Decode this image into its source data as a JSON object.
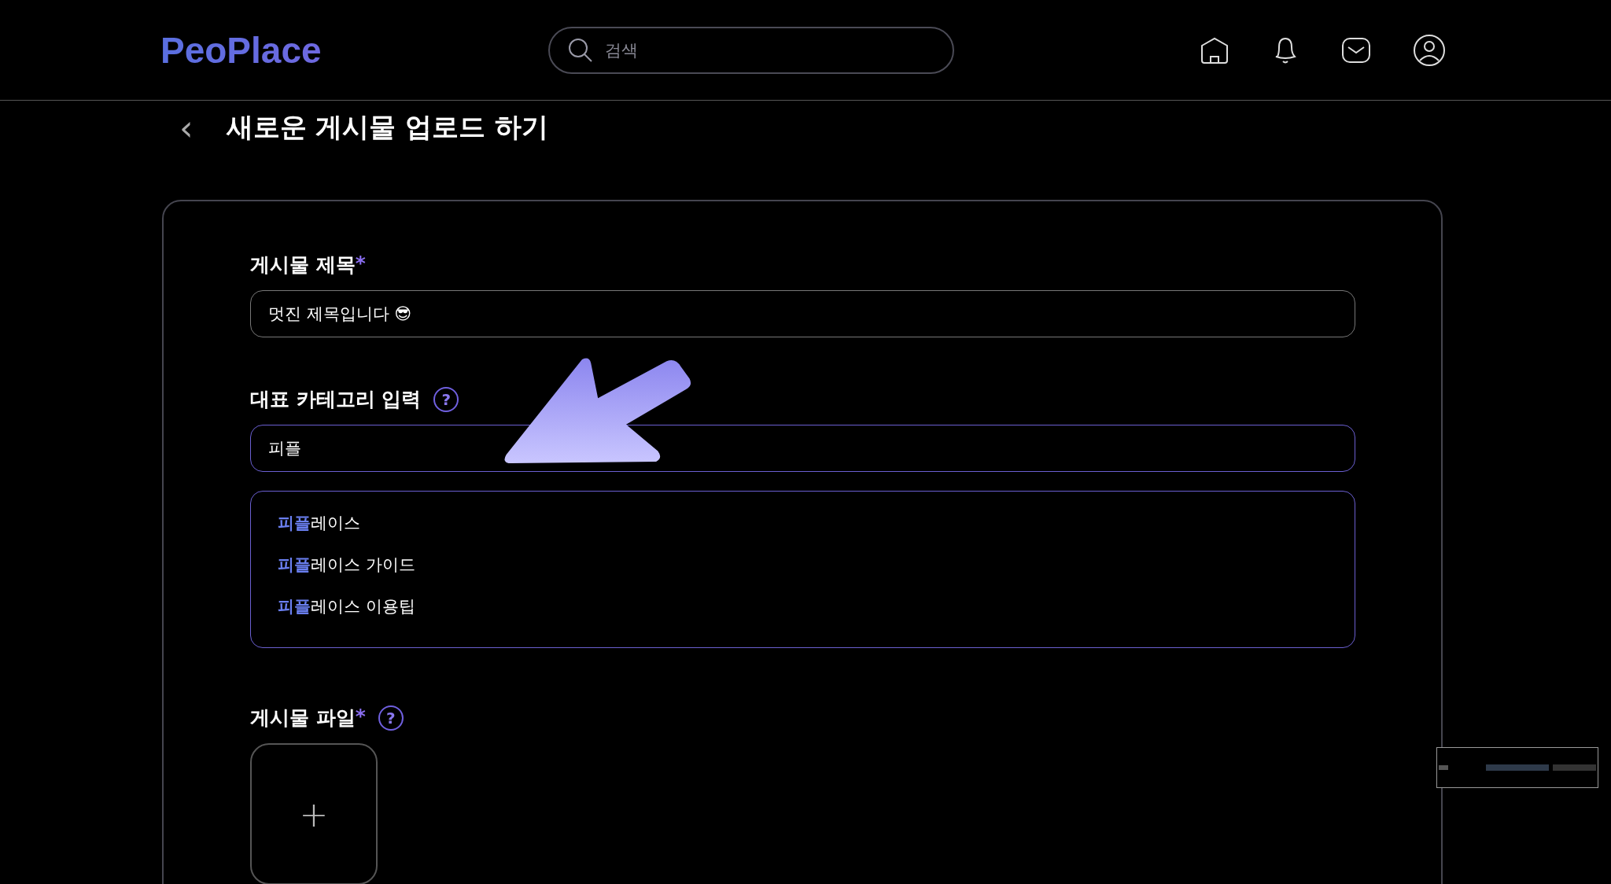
{
  "header": {
    "logo": "PeoPlace",
    "search": {
      "placeholder": "검색"
    }
  },
  "page": {
    "back": "‹",
    "title": "새로운 게시물 업로드 하기"
  },
  "form": {
    "title_field": {
      "label": "게시물 제목",
      "mark": "*",
      "value": "멋진 제목입니다 😎"
    },
    "category_field": {
      "label": "대표 카테고리 입력",
      "value": "피플",
      "help": "?"
    },
    "suggestions": [
      {
        "match": "피플",
        "rest": "레이스"
      },
      {
        "match": "피플",
        "rest": "레이스 가이드"
      },
      {
        "match": "피플",
        "rest": "레이스 이용팁"
      }
    ],
    "file_field": {
      "label": "게시물 파일",
      "mark": "*",
      "help": "?",
      "add": "+"
    }
  }
}
